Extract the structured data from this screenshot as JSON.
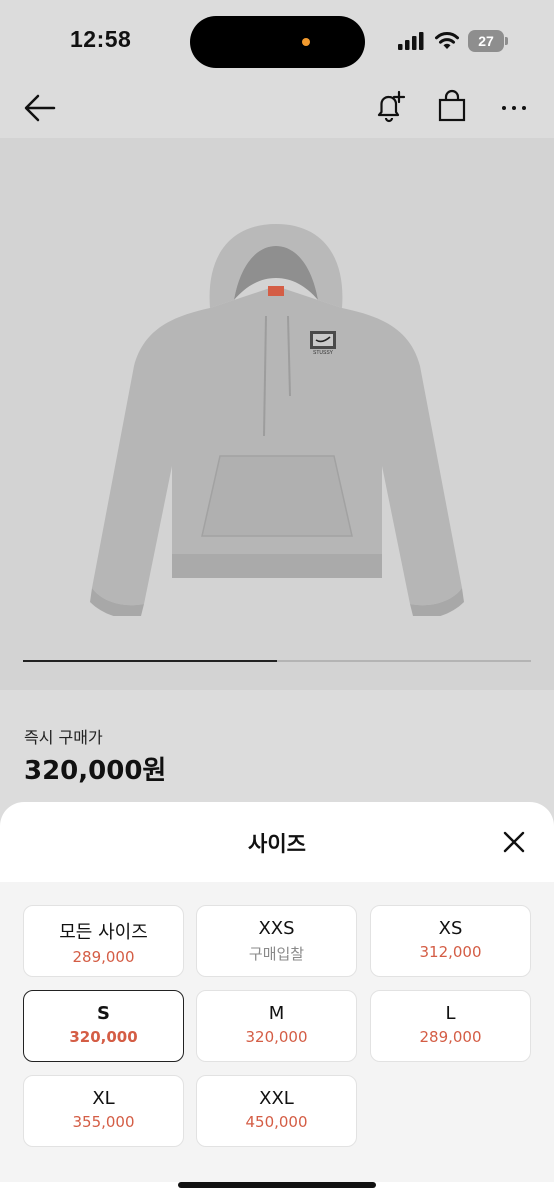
{
  "status_bar": {
    "time": "12:58",
    "battery": "27",
    "icons": [
      "signal-icon",
      "wifi-icon",
      "battery-icon"
    ]
  },
  "nav": {
    "icons": [
      "back-arrow-icon",
      "bell-plus-icon",
      "shopping-bag-icon",
      "more-horizontal-icon"
    ]
  },
  "product": {
    "image_subject": "grey-hoodie",
    "logo_text": "STUSSY",
    "image_progress": 0.5
  },
  "price": {
    "label": "즉시 구매가",
    "value": "320,000원"
  },
  "size_sheet": {
    "title": "사이즈",
    "options": [
      {
        "name": "모든 사이즈",
        "price": "289,000",
        "selected": false,
        "muted": false
      },
      {
        "name": "XXS",
        "price": "구매입찰",
        "selected": false,
        "muted": true
      },
      {
        "name": "XS",
        "price": "312,000",
        "selected": false,
        "muted": false
      },
      {
        "name": "S",
        "price": "320,000",
        "selected": true,
        "muted": false
      },
      {
        "name": "M",
        "price": "320,000",
        "selected": false,
        "muted": false
      },
      {
        "name": "L",
        "price": "289,000",
        "selected": false,
        "muted": false
      },
      {
        "name": "XL",
        "price": "355,000",
        "selected": false,
        "muted": false
      },
      {
        "name": "XXL",
        "price": "450,000",
        "selected": false,
        "muted": false
      }
    ]
  },
  "colors": {
    "price_accent": "#d45d45",
    "status_dot": "#f29a2e"
  }
}
